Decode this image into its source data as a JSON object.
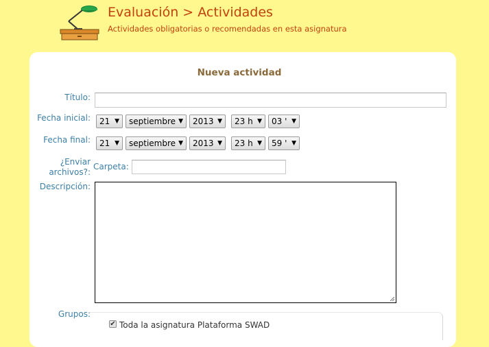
{
  "header": {
    "title": "Evaluación > Actividades",
    "subtitle": "Actividades obligatorias o recomendadas en esta asignatura",
    "icon": "desk-lamp-icon"
  },
  "form": {
    "heading": "Nueva actividad",
    "title_label": "Título:",
    "title_value": "",
    "start_label": "Fecha inicial:",
    "start": {
      "day": "21",
      "month": "septiembre",
      "year": "2013",
      "hour": "23 h",
      "minute": "03 '"
    },
    "end_label": "Fecha final:",
    "end": {
      "day": "21",
      "month": "septiembre",
      "year": "2013",
      "hour": "23 h",
      "minute": "59 '"
    },
    "send_files_label_line1": "¿Enviar",
    "send_files_label_line2": "archivos?:",
    "folder_label": "Carpeta:",
    "folder_value": "",
    "description_label": "Descripción:",
    "description_value": "",
    "groups_label": "Grupos:",
    "whole_course_label": "Toda la asignatura Plataforma SWAD",
    "whole_course_checked": true
  },
  "colors": {
    "background": "#fff88f",
    "header_text": "#c2410c",
    "label_text": "#3c7fa8",
    "heading_text": "#8a6a3a"
  }
}
